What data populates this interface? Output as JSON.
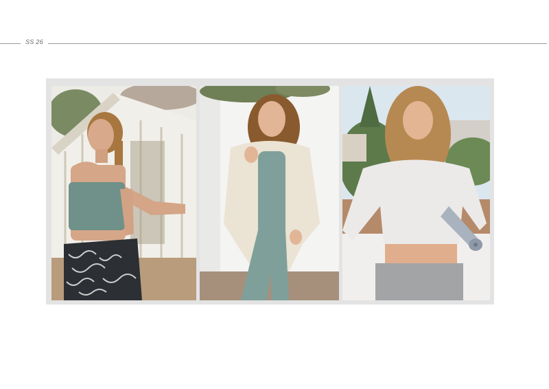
{
  "header": {
    "label": "SS 26"
  },
  "gallery": {
    "photos": [
      {
        "name": "photo-sage-bandeau-top-printed-leggings",
        "colors": {
          "top": "#6f9189",
          "legging": "#2c2f33",
          "skin": "#d8a98b",
          "hair": "#a7773f",
          "background": "#ecebe6"
        }
      },
      {
        "name": "photo-cream-fleece-jacket-sage-set",
        "colors": {
          "jacket": "#ebe3d3",
          "set": "#7fa09a",
          "skin": "#e2b597",
          "hair": "#8a5a2f",
          "background": "#f4f4f3"
        }
      },
      {
        "name": "photo-grey-twist-top-with-yoga-mat",
        "colors": {
          "top": "#ebeae8",
          "legging": "#a3a4a6",
          "mat": "#a9b3bf",
          "skin": "#e3b593",
          "hair": "#b78952",
          "sky": "#dbe7ef"
        }
      }
    ]
  }
}
